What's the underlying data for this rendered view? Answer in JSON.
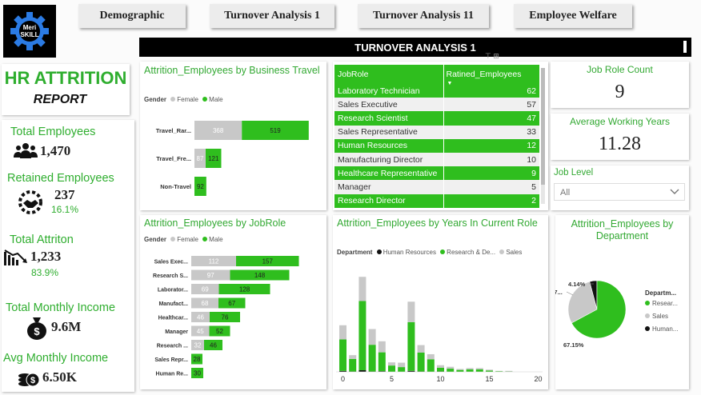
{
  "logo": {
    "line1": "Meri",
    "line2": "SKILL"
  },
  "nav": {
    "tabs": [
      "Demographic",
      "Turnover Analysis 1",
      "Turnover Analysis 11",
      "Employee Welfare"
    ]
  },
  "banner": {
    "title": "TURNOVER ANALYSIS 1"
  },
  "report": {
    "title": "HR ATTRITION",
    "subtitle": "REPORT"
  },
  "kpis": {
    "total_employees": {
      "label": "Total Employees",
      "value": "1,470"
    },
    "retained": {
      "label": "Retained Employees",
      "value": "237",
      "pct": "16.1%"
    },
    "attrition": {
      "label": "Total Attriton",
      "value": "1,233",
      "pct": "83.9%"
    },
    "monthly_income": {
      "label": "Total Monthly Income",
      "value": "9.6M"
    },
    "avg_income": {
      "label": "Avg Monthly Income",
      "value": "6.50K"
    }
  },
  "cards": {
    "job_role_count": {
      "label": "Job Role Count",
      "value": "9"
    },
    "avg_working_years": {
      "label": "Average Working Years",
      "value": "11.28"
    },
    "job_level": {
      "label": "Job Level",
      "value": "All"
    }
  },
  "colors": {
    "male": "#2fbe1e",
    "female": "#c8c8c8",
    "human_resources": "#111111",
    "research": "#2fbe1e",
    "sales": "#c8c8c8",
    "accent_text": "#33a933"
  },
  "table": {
    "headers": [
      "JobRole",
      "Ratined_Employees"
    ],
    "rows": [
      [
        "Laboratory Technician",
        "62"
      ],
      [
        "Sales Executive",
        "57"
      ],
      [
        "Research Scientist",
        "47"
      ],
      [
        "Sales Representative",
        "33"
      ],
      [
        "Human Resources",
        "12"
      ],
      [
        "Manufacturing Director",
        "10"
      ],
      [
        "Healthcare Representative",
        "9"
      ],
      [
        "Manager",
        "5"
      ],
      [
        "Research Director",
        "2"
      ]
    ]
  },
  "chart_data": [
    {
      "type": "bar",
      "title": "Attrition_Employees by Business Travel",
      "legend_title": "Gender",
      "orientation": "horizontal",
      "stacked": true,
      "categories": [
        "Travel_Rar...",
        "Travel_Fre...",
        "Non-Travel"
      ],
      "series": [
        {
          "name": "Female",
          "values": [
            368,
            87,
            null
          ]
        },
        {
          "name": "Male",
          "values": [
            519,
            121,
            92
          ]
        }
      ]
    },
    {
      "type": "bar",
      "title": "Attrition_Employees by JobRole",
      "legend_title": "Gender",
      "orientation": "horizontal",
      "stacked": true,
      "categories": [
        "Sales Exec...",
        "Research S...",
        "Laborator...",
        "Manufact...",
        "Healthcar...",
        "Manager",
        "Research ...",
        "Sales Repr...",
        "Human Re..."
      ],
      "series": [
        {
          "name": "Female",
          "values": [
            112,
            97,
            69,
            68,
            46,
            45,
            32,
            null,
            null
          ]
        },
        {
          "name": "Male",
          "values": [
            157,
            148,
            128,
            67,
            76,
            52,
            46,
            28,
            30
          ]
        }
      ]
    },
    {
      "type": "bar",
      "title": "Attrition_Employees by Years In Current Role",
      "legend_title": "Department",
      "stacked": true,
      "x": [
        0,
        1,
        2,
        3,
        4,
        5,
        6,
        7,
        8,
        9,
        10,
        11,
        12,
        13,
        14,
        15,
        16,
        17,
        18,
        19,
        20
      ],
      "xticks": [
        0,
        5,
        10,
        15,
        20
      ],
      "series": [
        {
          "name": "Human Resources",
          "values": [
            3,
            1,
            5,
            1,
            2,
            0,
            0,
            3,
            1,
            0,
            1,
            0,
            0,
            0,
            0,
            0,
            0,
            0,
            0,
            0,
            0
          ]
        },
        {
          "name": "Research & De...",
          "values": [
            100,
            40,
            220,
            85,
            60,
            20,
            15,
            155,
            60,
            40,
            12,
            10,
            6,
            8,
            8,
            4,
            2,
            1,
            0,
            0,
            0
          ]
        },
        {
          "name": "Sales",
          "values": [
            45,
            12,
            77,
            50,
            35,
            10,
            14,
            65,
            24,
            16,
            8,
            6,
            3,
            4,
            4,
            3,
            1,
            2,
            0,
            0,
            0
          ]
        }
      ]
    },
    {
      "type": "pie",
      "title": "Attrition_Employees by Department",
      "legend_title": "Departm...",
      "labels": [
        "Resear...",
        "Sales",
        "Human..."
      ],
      "values": [
        67.15,
        28.7,
        4.14
      ],
      "data_labels": [
        "67.15%",
        "28.7...",
        "4.14%"
      ]
    }
  ]
}
